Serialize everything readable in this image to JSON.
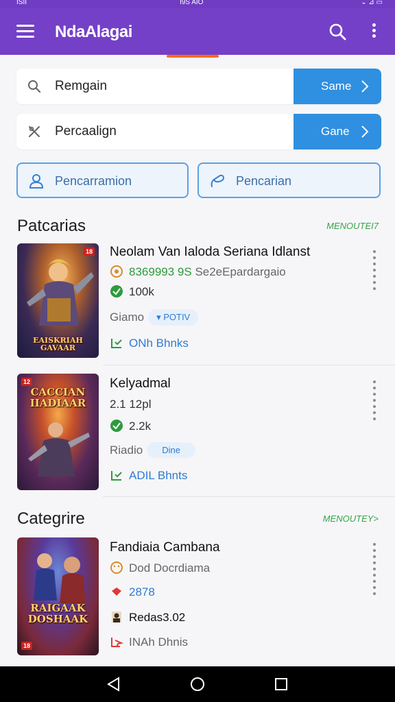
{
  "status_bar": {
    "left": "ISII",
    "center": "I9S AIO",
    "right": "⌄ ⊿ ▭"
  },
  "app_bar": {
    "title": "NdaAlagai"
  },
  "search_fields": [
    {
      "text": "Remgain",
      "button_label": "Same",
      "icon": "search-icon"
    },
    {
      "text": "Percaalign",
      "button_label": "Gane",
      "icon": "close-icon"
    }
  ],
  "outline_buttons": [
    {
      "label": "Pencarramion",
      "icon": "user-icon"
    },
    {
      "label": "Pencarian",
      "icon": "link-icon"
    }
  ],
  "sections": [
    {
      "title": "Patcarias",
      "link": "MENOUTEI7",
      "items": [
        {
          "title": "Neolam Van Ialoda Seriana Idlanst",
          "meta_number": "8369993 9S",
          "meta_text": "Se2eEpardargaio",
          "downloads": "100k",
          "tag_label": "Giamo",
          "tag_pill": "▾ POTIV",
          "action": "ONh Bhnks",
          "thumb_title": "EAISKRIAH GAVAAR",
          "thumb_badge": "18"
        },
        {
          "title": "Kelyadmal",
          "meta_number": "2.1 12pl",
          "meta_text": "",
          "downloads": "2.2k",
          "tag_label": "Riadio",
          "tag_pill": "Dine",
          "action": "ADIL Bhnts",
          "thumb_title": "CACCIAN IIADIAAR",
          "thumb_badge": "12"
        }
      ]
    },
    {
      "title": "Categrire",
      "link": "MENOUTEY>",
      "items": [
        {
          "title": "Fandiaia Cambana",
          "meta_number": "",
          "meta_text": "Dod Docrdiama",
          "downloads": "2878",
          "tag_label": "Redas3.02",
          "tag_pill": "",
          "action": "INAh Dhnis",
          "thumb_title": "RAIGAAK DOSHAAK",
          "thumb_badge": "18"
        }
      ]
    }
  ],
  "colors": {
    "appbar": "#7440c8",
    "accent_blue": "#2f8fe1",
    "link_green": "#35a548",
    "tab_indicator": "#ff6a1a"
  }
}
